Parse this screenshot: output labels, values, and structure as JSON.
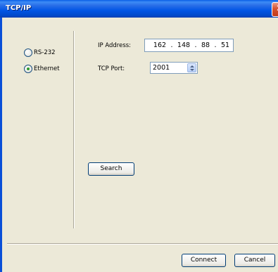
{
  "window": {
    "title": "TCP/IP"
  },
  "connection_type": {
    "options": [
      {
        "label": "RS-232",
        "checked": false
      },
      {
        "label": "Ethernet",
        "checked": true
      }
    ]
  },
  "ip_address": {
    "label": "IP Address:",
    "octets": [
      "162",
      "148",
      "88",
      "51"
    ]
  },
  "tcp_port": {
    "label": "TCP Port:",
    "value": "2001"
  },
  "buttons": {
    "search": "Search",
    "connect": "Connect",
    "cancel": "Cancel"
  },
  "icons": {
    "close": "close-icon",
    "spin_up": "chevron-up-icon",
    "spin_down": "chevron-down-icon"
  },
  "colors": {
    "titlebar": "#0055e5",
    "dialog_bg": "#ece9d8",
    "close_btn": "#d6512f",
    "radio_dot": "#2e9b2e"
  }
}
